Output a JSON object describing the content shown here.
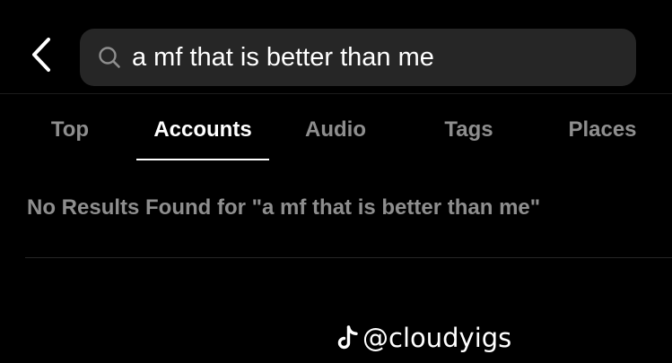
{
  "header": {
    "back_icon": "chevron-left-icon",
    "search_icon": "search-icon",
    "search_value": "a mf that is better than me"
  },
  "tabs": [
    {
      "label": "Top",
      "active": false
    },
    {
      "label": "Accounts",
      "active": true
    },
    {
      "label": "Audio",
      "active": false
    },
    {
      "label": "Tags",
      "active": false
    },
    {
      "label": "Places",
      "active": false
    }
  ],
  "results": {
    "message": "No Results Found for \"a mf that is better than me\""
  },
  "watermark": {
    "icon": "tiktok-icon",
    "text": "@cloudyigs"
  },
  "colors": {
    "background": "#000000",
    "search_field": "#262626",
    "inactive_text": "#8e8e8e",
    "active_text": "#ffffff"
  }
}
